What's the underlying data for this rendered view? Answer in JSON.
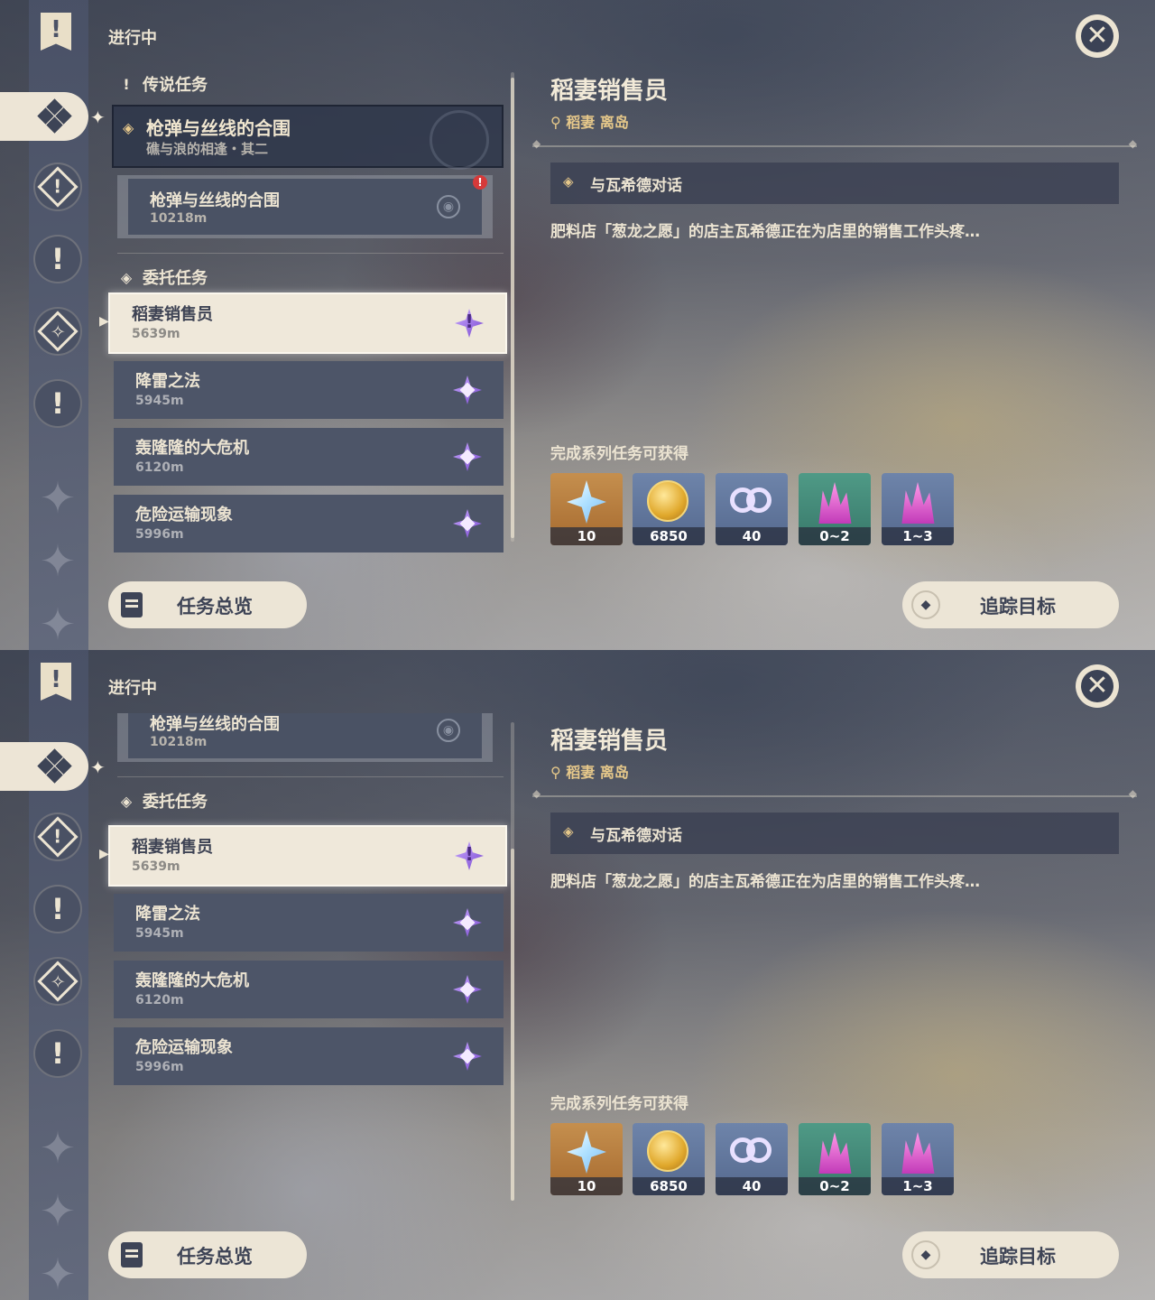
{
  "header": {
    "status_label": "进行中",
    "close_icon": "close-icon"
  },
  "sidebar": {
    "items": [
      {
        "icon": "quest-banner-icon",
        "glyph": "!"
      },
      {
        "icon": "all-quests-icon"
      },
      {
        "icon": "archon-quest-icon",
        "glyph": "!"
      },
      {
        "icon": "story-quest-icon",
        "glyph": "!"
      },
      {
        "icon": "world-quest-icon",
        "glyph": "✧"
      },
      {
        "icon": "event-quest-icon",
        "glyph": "!"
      }
    ]
  },
  "quest_list": {
    "legend_section": {
      "label": "传说任务",
      "icon": "legend-quest-icon",
      "glyph": "!"
    },
    "legend_quest": {
      "title": "枪弹与丝线的合围",
      "subtitle": "礁与浪的相逢・其二",
      "marker": "◈"
    },
    "legend_subquest": {
      "title": "枪弹与丝线的合围",
      "distance": "10218m",
      "alert": "!",
      "pin_icon": "location-pin-icon"
    },
    "commission_section": {
      "label": "委托任务",
      "icon": "commission-quest-icon",
      "glyph": "◈"
    },
    "commissions": [
      {
        "title": "稻妻销售员",
        "distance": "5639m",
        "selected": true
      },
      {
        "title": "降雷之法",
        "distance": "5945m",
        "selected": false
      },
      {
        "title": "轰隆隆的大危机",
        "distance": "6120m",
        "selected": false
      },
      {
        "title": "危险运输现象",
        "distance": "5996m",
        "selected": false
      }
    ]
  },
  "detail": {
    "title": "稻妻销售员",
    "location": "稻妻 离岛",
    "objective": "与瓦希德对话",
    "description": "肥料店「葱龙之愿」的店主瓦希德正在为店里的销售工作头疼…",
    "rewards_label": "完成系列任务可获得",
    "rewards": [
      {
        "icon": "primogem-icon",
        "qty": "10"
      },
      {
        "icon": "mora-icon",
        "qty": "6850"
      },
      {
        "icon": "companionship-exp-icon",
        "qty": "40"
      },
      {
        "icon": "crystal-ore-icon",
        "qty": "0~2"
      },
      {
        "icon": "crystal-chunk-icon",
        "qty": "1~3"
      }
    ]
  },
  "footer": {
    "overview_label": "任务总览",
    "track_label": "追踪目标",
    "overview_icon": "quest-overview-icon",
    "track_icon": "track-target-icon"
  },
  "colors": {
    "accent_gold": "#e6c88a",
    "panel_cream": "#ece5d6",
    "quest_purple": "#7a4ad0"
  }
}
